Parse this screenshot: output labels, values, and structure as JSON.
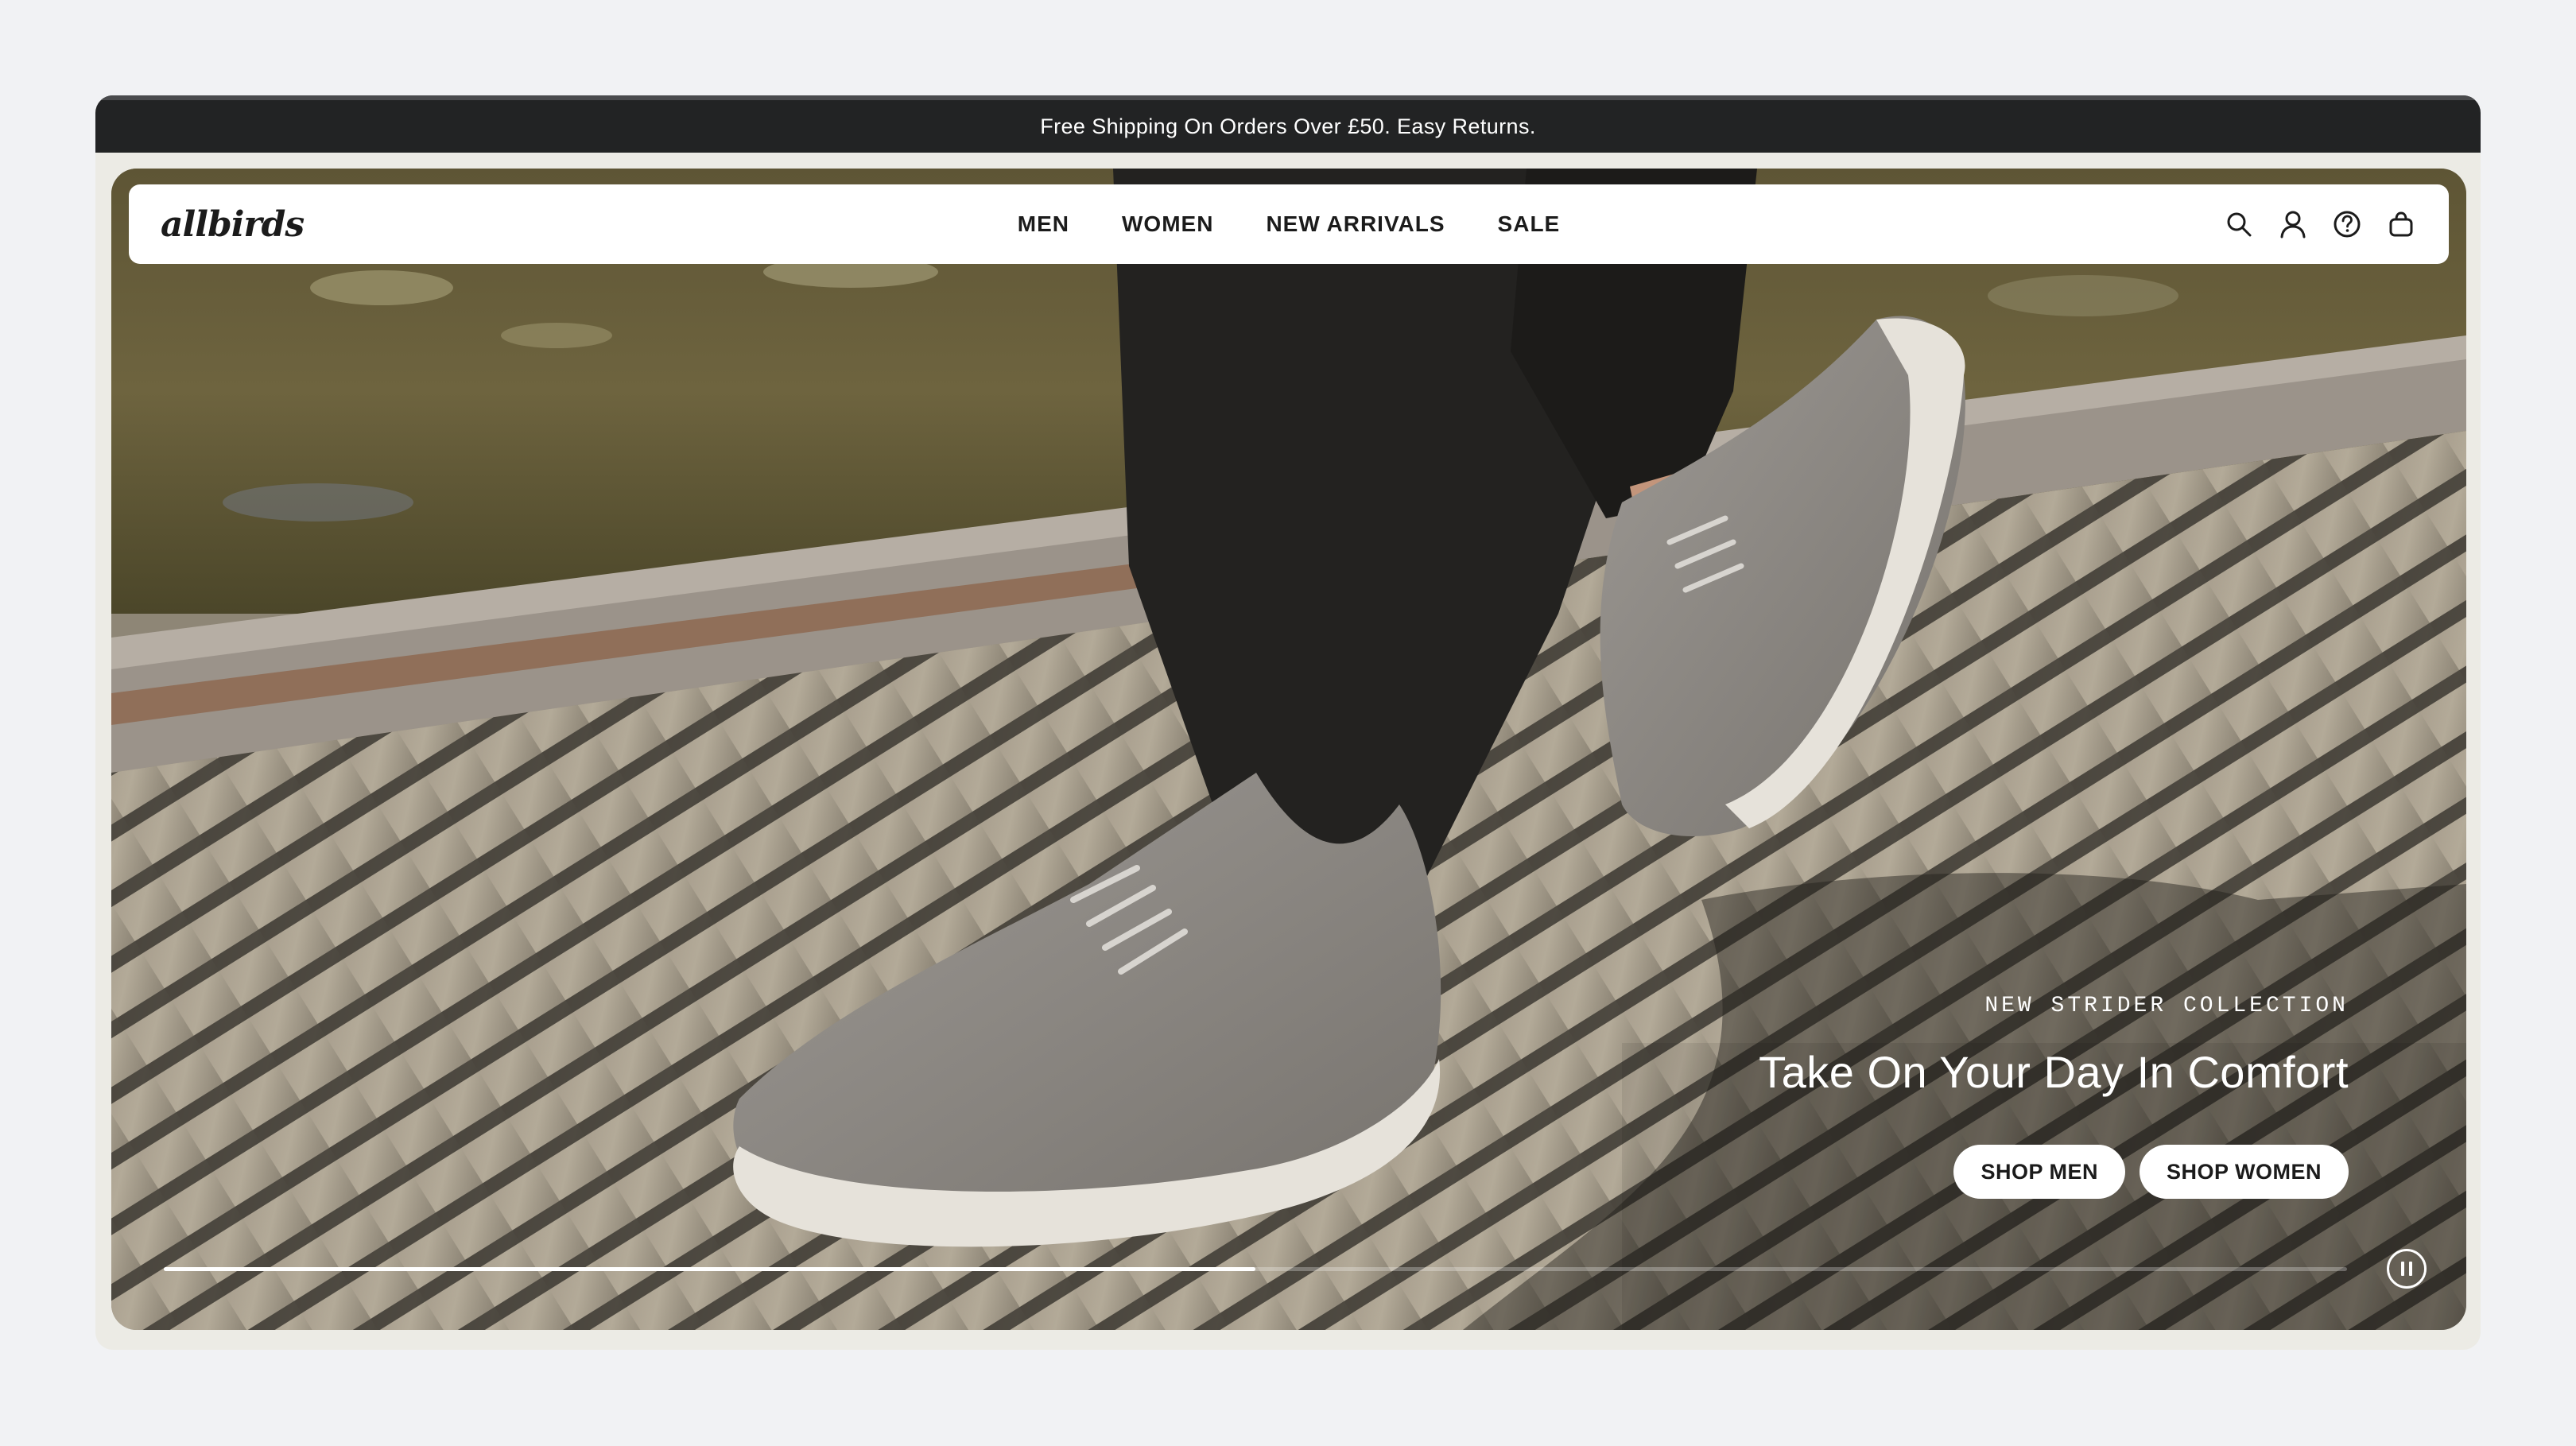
{
  "announcement": {
    "text": "Free Shipping On Orders Over £50. Easy Returns."
  },
  "header": {
    "logo": "allbirds",
    "nav": [
      {
        "label": "MEN"
      },
      {
        "label": "WOMEN"
      },
      {
        "label": "NEW ARRIVALS"
      },
      {
        "label": "SALE"
      }
    ],
    "icons": [
      "search-icon",
      "account-icon",
      "help-icon",
      "cart-icon"
    ]
  },
  "hero": {
    "eyebrow": "NEW STRIDER COLLECTION",
    "headline": "Take On Your Day In Comfort",
    "buttons": [
      {
        "label": "SHOP MEN"
      },
      {
        "label": "SHOP WOMEN"
      }
    ],
    "carousel_progress": 0.5,
    "carousel_control": "pause-icon"
  },
  "colors": {
    "page_background": "#f1f2f4",
    "announcement_bar": "#222324",
    "frame": "#ecebe5",
    "nav_background": "#ffffff",
    "text_dark": "#1b1b1b",
    "shoe_grey": "#8f8c88",
    "sole": "#e6e2da"
  }
}
